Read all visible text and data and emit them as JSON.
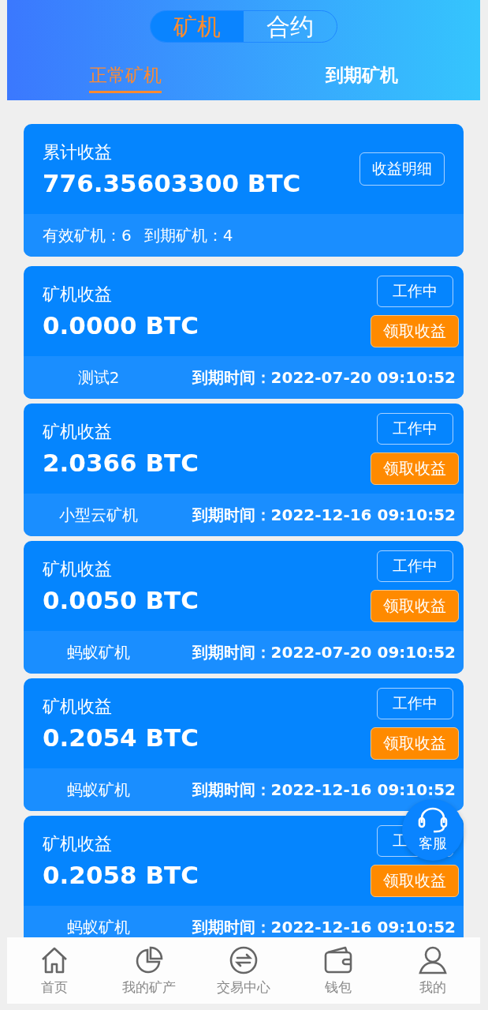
{
  "header": {
    "segments": [
      {
        "label": "矿机",
        "selected": true
      },
      {
        "label": "合约",
        "selected": false
      }
    ],
    "tabs": [
      {
        "label": "正常矿机",
        "selected": true
      },
      {
        "label": "到期矿机",
        "selected": false
      }
    ]
  },
  "summary": {
    "label": "累计收益",
    "value": "776.35603300 BTC",
    "button": "收益明细",
    "stats": [
      "有效矿机：6",
      "到期矿机：4"
    ]
  },
  "miners": [
    {
      "label": "矿机收益",
      "value": "0.0000 BTC",
      "status": "工作中",
      "action": "领取收益",
      "name": "测试2",
      "expiry": "到期时间：2022-07-20 09:10:52"
    },
    {
      "label": "矿机收益",
      "value": "2.0366 BTC",
      "status": "工作中",
      "action": "领取收益",
      "name": "小型云矿机",
      "expiry": "到期时间：2022-12-16 09:10:52"
    },
    {
      "label": "矿机收益",
      "value": "0.0050 BTC",
      "status": "工作中",
      "action": "领取收益",
      "name": "蚂蚁矿机",
      "expiry": "到期时间：2022-07-20 09:10:52"
    },
    {
      "label": "矿机收益",
      "value": "0.2054 BTC",
      "status": "工作中",
      "action": "领取收益",
      "name": "蚂蚁矿机",
      "expiry": "到期时间：2022-12-16 09:10:52"
    },
    {
      "label": "矿机收益",
      "value": "0.2058 BTC",
      "status": "工",
      "action": "领取收益",
      "name": "蚂蚁矿机",
      "expiry": "到期时间：2022-12-16 09:10:52"
    }
  ],
  "support_button": {
    "label": "客服"
  },
  "nav": [
    {
      "label": "首页",
      "kind": "home"
    },
    {
      "label": "我的矿产",
      "kind": "pie"
    },
    {
      "label": "交易中心",
      "kind": "exchange"
    },
    {
      "label": "钱包",
      "kind": "wallet"
    },
    {
      "label": "我的",
      "kind": "user"
    }
  ]
}
